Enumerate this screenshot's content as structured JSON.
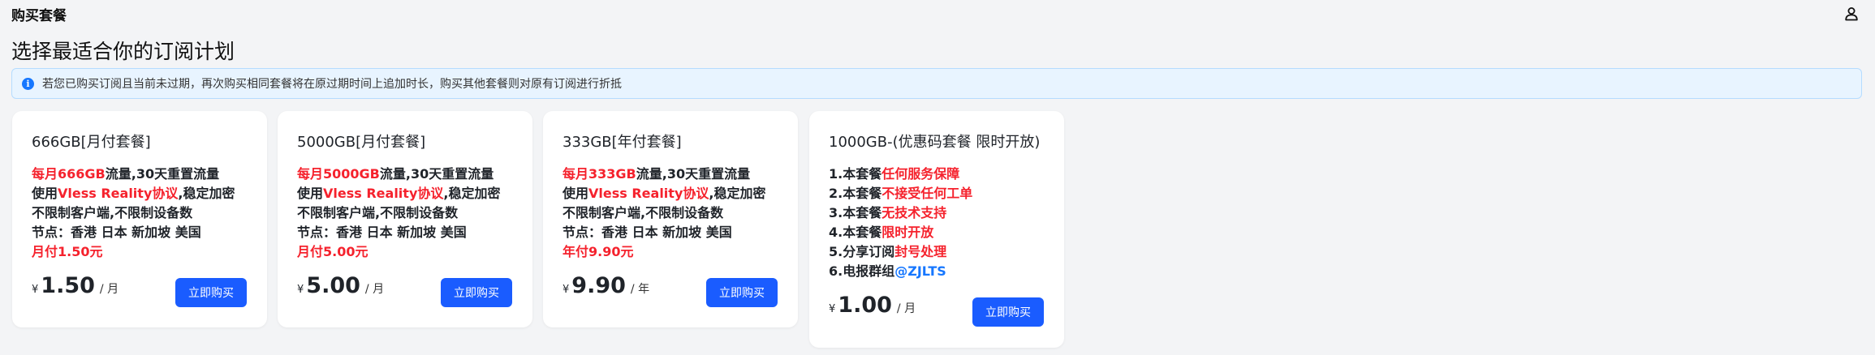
{
  "header": {
    "title": "购买套餐",
    "user_icon": "user-icon"
  },
  "page": {
    "title": "选择最适合你的订阅计划"
  },
  "notice": {
    "icon": "info-icon",
    "text": "若您已购买订阅且当前未过期，再次购买相同套餐将在原过期时间上追加时长，购买其他套餐则对原有订阅进行折抵"
  },
  "colors": {
    "highlight_red": "#f5222d",
    "highlight_blue": "#1677ff",
    "button": "#1a5cff"
  },
  "plans": [
    {
      "title": "666GB[月付套餐]",
      "features": [
        [
          {
            "t": "每月666GB",
            "c": "red"
          },
          {
            "t": "流量,30天重置流量"
          }
        ],
        [
          {
            "t": "使用"
          },
          {
            "t": "Vless Reality协议",
            "c": "red"
          },
          {
            "t": ",稳定加密"
          }
        ],
        [
          {
            "t": "不限制客户端,不限制设备数"
          }
        ],
        [
          {
            "t": "节点：香港 日本 新加坡 美国"
          }
        ],
        [
          {
            "t": "月付1.50元",
            "c": "red"
          }
        ]
      ],
      "currency": "¥",
      "price": "1.50",
      "unit": "/ 月",
      "button": "立即购买"
    },
    {
      "title": "5000GB[月付套餐]",
      "features": [
        [
          {
            "t": "每月5000GB",
            "c": "red"
          },
          {
            "t": "流量,30天重置流量"
          }
        ],
        [
          {
            "t": "使用"
          },
          {
            "t": "Vless Reality协议",
            "c": "red"
          },
          {
            "t": ",稳定加密"
          }
        ],
        [
          {
            "t": "不限制客户端,不限制设备数"
          }
        ],
        [
          {
            "t": "节点：香港 日本 新加坡 美国"
          }
        ],
        [
          {
            "t": "月付5.00元",
            "c": "red"
          }
        ]
      ],
      "currency": "¥",
      "price": "5.00",
      "unit": "/ 月",
      "button": "立即购买"
    },
    {
      "title": "333GB[年付套餐]",
      "features": [
        [
          {
            "t": "每月333GB",
            "c": "red"
          },
          {
            "t": "流量,30天重置流量"
          }
        ],
        [
          {
            "t": "使用"
          },
          {
            "t": "Vless Reality协议",
            "c": "red"
          },
          {
            "t": ",稳定加密"
          }
        ],
        [
          {
            "t": "不限制客户端,不限制设备数"
          }
        ],
        [
          {
            "t": "节点：香港 日本 新加坡 美国"
          }
        ],
        [
          {
            "t": "年付9.90元",
            "c": "red"
          }
        ]
      ],
      "currency": "¥",
      "price": "9.90",
      "unit": "/ 年",
      "button": "立即购买"
    },
    {
      "title": "1000GB-(优惠码套餐 限时开放)",
      "features": [
        [
          {
            "t": "1.本套餐"
          },
          {
            "t": "任何服务保障",
            "c": "red"
          }
        ],
        [
          {
            "t": "2.本套餐"
          },
          {
            "t": "不接受任何工单",
            "c": "red"
          }
        ],
        [
          {
            "t": "3.本套餐"
          },
          {
            "t": "无技术支持",
            "c": "red"
          }
        ],
        [
          {
            "t": "4.本套餐"
          },
          {
            "t": "限时开放",
            "c": "red"
          }
        ],
        [
          {
            "t": "5.分享订阅"
          },
          {
            "t": "封号处理",
            "c": "red"
          }
        ],
        [
          {
            "t": "6.电报群组"
          },
          {
            "t": "@ZJLTS",
            "c": "blue"
          }
        ]
      ],
      "currency": "¥",
      "price": "1.00",
      "unit": "/ 月",
      "button": "立即购买"
    }
  ]
}
